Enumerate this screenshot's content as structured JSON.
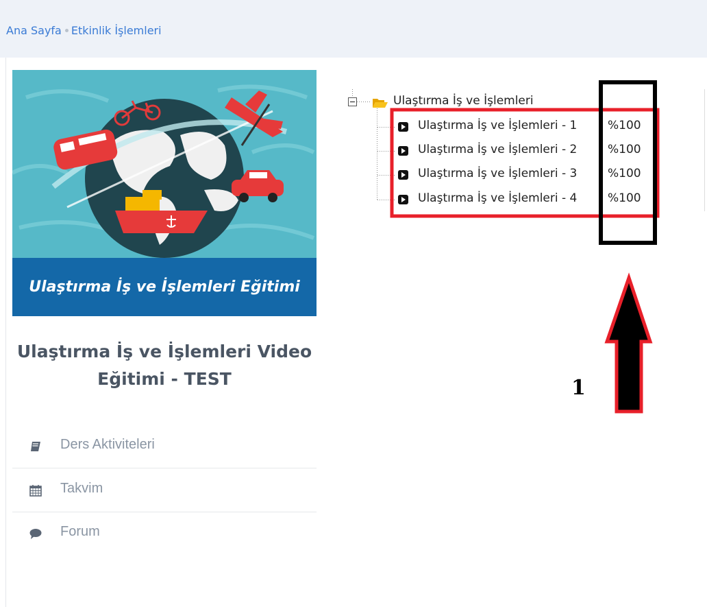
{
  "breadcrumb": {
    "home": "Ana Sayfa",
    "current": "Etkinlik İşlemleri"
  },
  "course": {
    "banner_caption": "Ulaştırma İş ve İşlemleri Eğitimi",
    "title_line1": "Ulaştırma İş ve İşlemleri Video",
    "title_line2": "Eğitimi - TEST"
  },
  "menu": [
    {
      "label": "Ders Aktiviteleri",
      "icon": "book-icon"
    },
    {
      "label": "Takvim",
      "icon": "calendar-icon"
    },
    {
      "label": "Forum",
      "icon": "comment-icon"
    }
  ],
  "tree": {
    "folder": {
      "label": "Ulaştırma İş ve İşlemleri",
      "icon": "folder-open-icon",
      "expanded": true
    },
    "items": [
      {
        "label": "Ulaştırma İş ve İşlemleri - 1",
        "progress": "%100",
        "icon": "play-icon"
      },
      {
        "label": "Ulaştırma İş ve İşlemleri - 2",
        "progress": "%100",
        "icon": "play-icon"
      },
      {
        "label": "Ulaştırma İş ve İşlemleri - 3",
        "progress": "%100",
        "icon": "play-icon"
      },
      {
        "label": "Ulaştırma İş ve İşlemleri - 4",
        "progress": "%100",
        "icon": "play-icon"
      }
    ]
  },
  "annotation": {
    "number": "1",
    "box_red": "#e8202a",
    "box_black": "#000000",
    "arrow_fill": "#000000"
  },
  "colors": {
    "link": "#3a7bd5",
    "banner_caption_bg": "#1468a8",
    "banner_bg": "#52b6c6",
    "folder": "#f4b400"
  }
}
